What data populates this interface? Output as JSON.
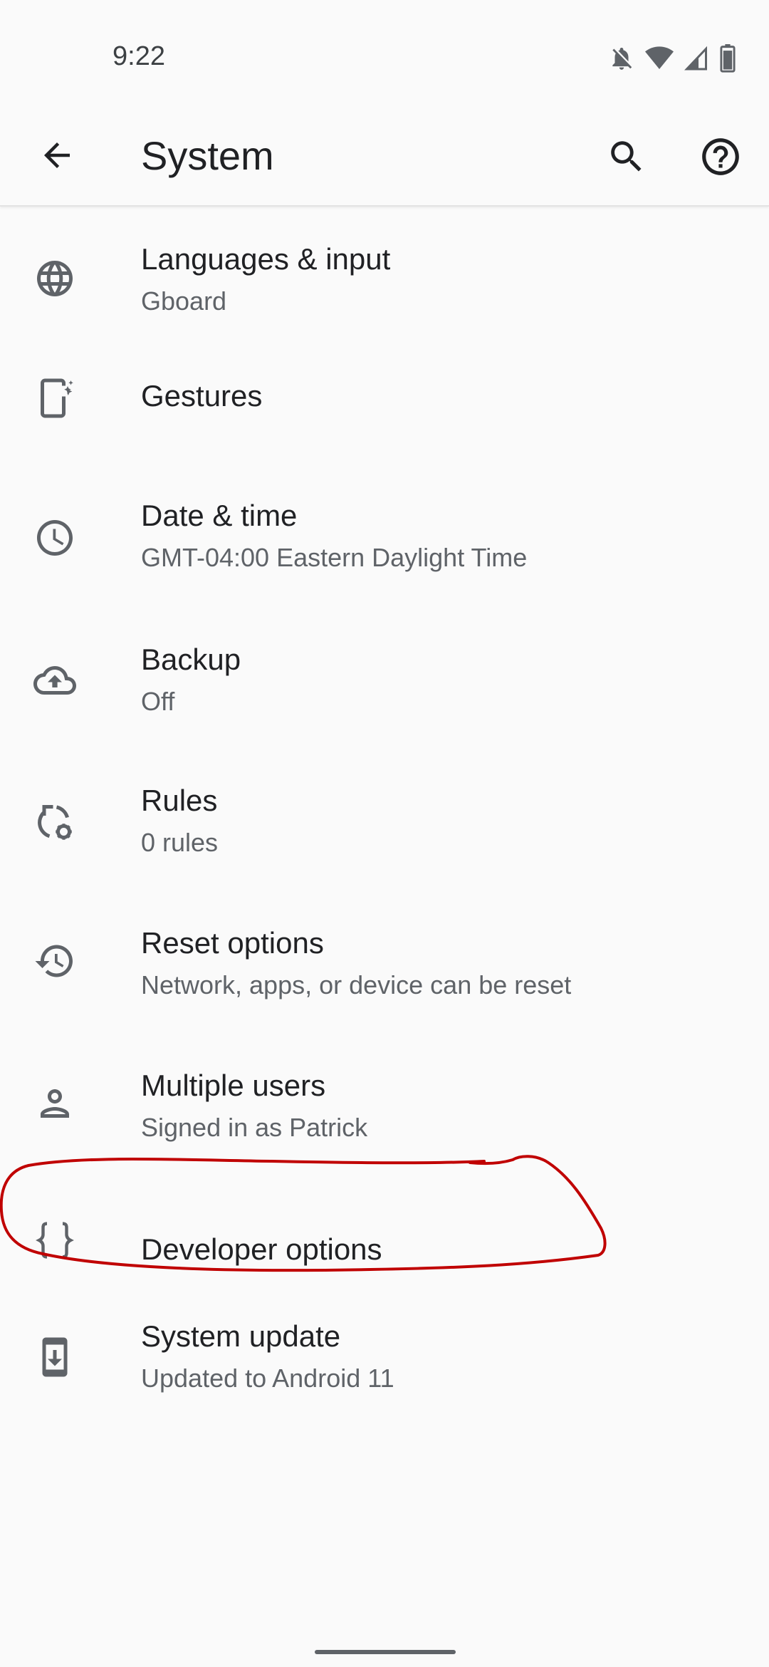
{
  "status_bar": {
    "time": "9:22",
    "icons": [
      "notifications-off-icon",
      "wifi-icon",
      "signal-icon",
      "battery-icon"
    ]
  },
  "app_bar": {
    "title": "System",
    "back_icon": "arrow-back-icon",
    "search_icon": "search-icon",
    "help_icon": "help-icon"
  },
  "settings": [
    {
      "icon": "globe-icon",
      "title": "Languages & input",
      "summary": "Gboard"
    },
    {
      "icon": "gestures-icon",
      "title": "Gestures",
      "summary": ""
    },
    {
      "icon": "clock-icon",
      "title": "Date & time",
      "summary": "GMT-04:00 Eastern Daylight Time"
    },
    {
      "icon": "cloud-upload-icon",
      "title": "Backup",
      "summary": "Off"
    },
    {
      "icon": "rules-icon",
      "title": "Rules",
      "summary": "0 rules"
    },
    {
      "icon": "history-icon",
      "title": "Reset options",
      "summary": "Network, apps, or device can be reset"
    },
    {
      "icon": "person-icon",
      "title": "Multiple users",
      "summary": "Signed in as Patrick"
    },
    {
      "icon": "code-braces-icon",
      "title": "Developer options",
      "summary": ""
    },
    {
      "icon": "system-update-icon",
      "title": "System update",
      "summary": "Updated to Android 11"
    }
  ],
  "colors": {
    "background": "#fafafa",
    "text_primary": "#202124",
    "text_secondary": "#5f6368",
    "icon": "#5f6368",
    "annotation": "#c00000"
  }
}
